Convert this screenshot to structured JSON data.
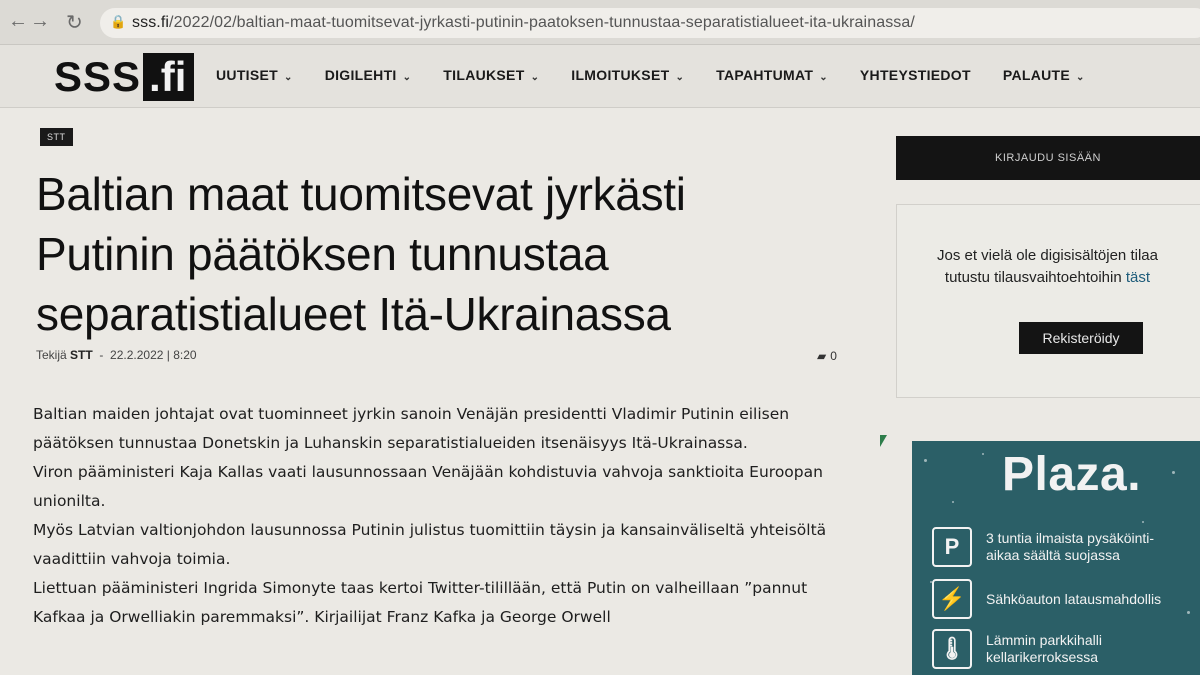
{
  "browser": {
    "url_host": "sss.fi",
    "url_path": "/2022/02/baltian-maat-tuomitsevat-jyrkasti-putinin-paatoksen-tunnustaa-separatistialueet-ita-ukrainassa/"
  },
  "site": {
    "logo_part1": "SSS",
    "logo_part2": ".fi",
    "menu": [
      {
        "label": "UUTISET",
        "has_dropdown": true
      },
      {
        "label": "DIGILEHTI",
        "has_dropdown": true
      },
      {
        "label": "TILAUKSET",
        "has_dropdown": true
      },
      {
        "label": "ILMOITUKSET",
        "has_dropdown": true
      },
      {
        "label": "TAPAHTUMAT",
        "has_dropdown": true
      },
      {
        "label": "YHTEYSTIEDOT",
        "has_dropdown": false
      },
      {
        "label": "PALAUTE",
        "has_dropdown": true
      }
    ]
  },
  "article": {
    "category": "STT",
    "headline_lines": [
      "Baltian maat tuomitsevat jyrkästi",
      "Putinin päätöksen tunnustaa",
      "separatistialueet Itä-Ukrainassa"
    ],
    "byline_prefix": "Tekijä",
    "author": "STT",
    "date": "22.2.2022",
    "time": "8:20",
    "comment_count": "0",
    "paragraphs": [
      "Baltian maiden johtajat ovat tuominneet jyrkin sanoin Venäjän presidentti Vladimir Putinin eilisen päätöksen tunnustaa Donetskin ja Luhanskin separatistialueiden itsenäisyys Itä-Ukrainassa.",
      "Viron pääministeri Kaja Kallas vaati lausunnossaan Venäjään kohdistuvia vahvoja sanktioita Euroopan unionilta.",
      "Myös Latvian valtionjohdon lausunnossa Putinin julistus tuomittiin täysin ja kansainväliseltä yhteisöltä vaadittiin vahvoja toimia.",
      "Liettuan pääministeri Ingrida Simonyte taas kertoi Twitter-tilillään, että Putin on valheillaan ”pannut Kafkaa ja Orwelliakin paremmaksi”. Kirjailijat Franz Kafka ja George Orwell"
    ]
  },
  "sidebar": {
    "login_label": "KIRJAUDU SISÄÄN",
    "subscribe_line1": "Jos et vielä ole digisisältöjen tilaa",
    "subscribe_line2_prefix": "tutustu tilausvaihtoehtoihin ",
    "subscribe_link": "täst",
    "register_label": "Rekisteröidy"
  },
  "ad": {
    "brand": "Plaza.",
    "features": [
      {
        "icon": "parking-icon",
        "glyph": "P",
        "line1": "3 tuntia ilmaista pysäköinti-",
        "line2": "aikaa säältä suojassa"
      },
      {
        "icon": "ev-charging-icon",
        "glyph": "⚡",
        "line1": "Sähköauton latausmahdollis",
        "line2": ""
      },
      {
        "icon": "thermometer-icon",
        "glyph": "🌡",
        "line1": "Lämmin parkkihalli",
        "line2": "kellarikerroksessa"
      }
    ]
  }
}
